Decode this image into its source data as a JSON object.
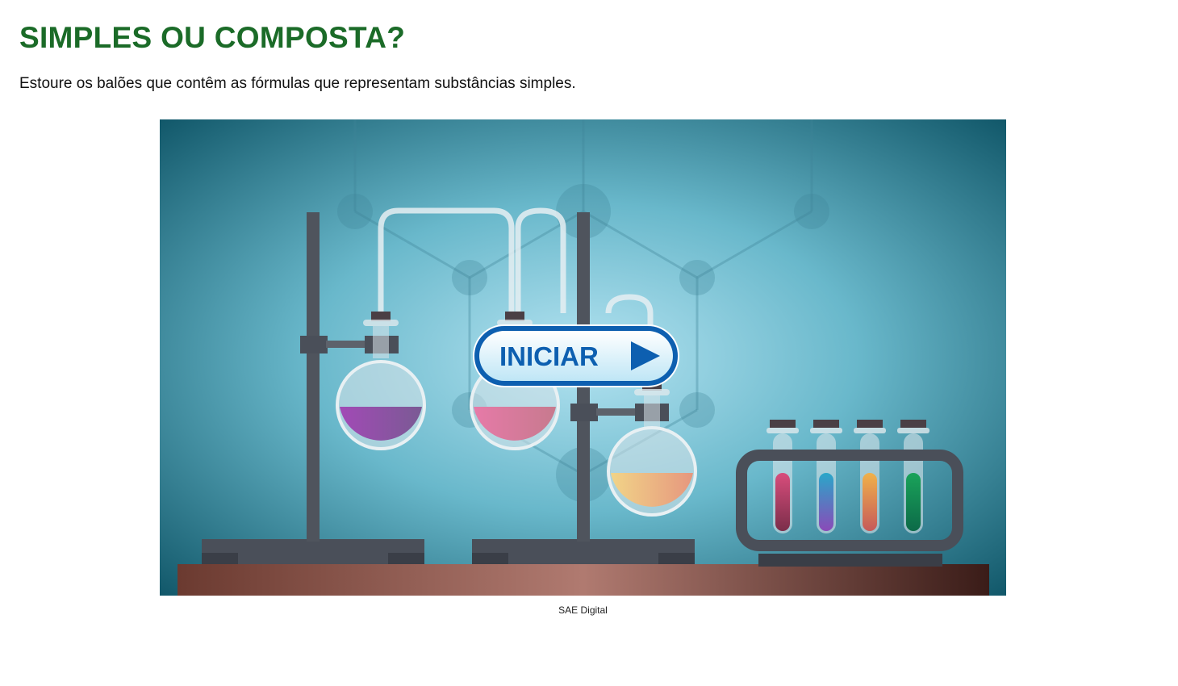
{
  "page": {
    "title": "SIMPLES OU COMPOSTA?",
    "instruction": "Estoure os balões que contêm as fórmulas que representam substâncias simples."
  },
  "game": {
    "start_label": "INICIAR",
    "start_icon": "play-arrow-icon",
    "scene": "chemistry-laboratory-illustration",
    "caption": "SAE Digital"
  },
  "colors": {
    "title": "#1b6b28",
    "button_blue": "#0d5fb0",
    "background_teal": "#4fa8bd"
  }
}
